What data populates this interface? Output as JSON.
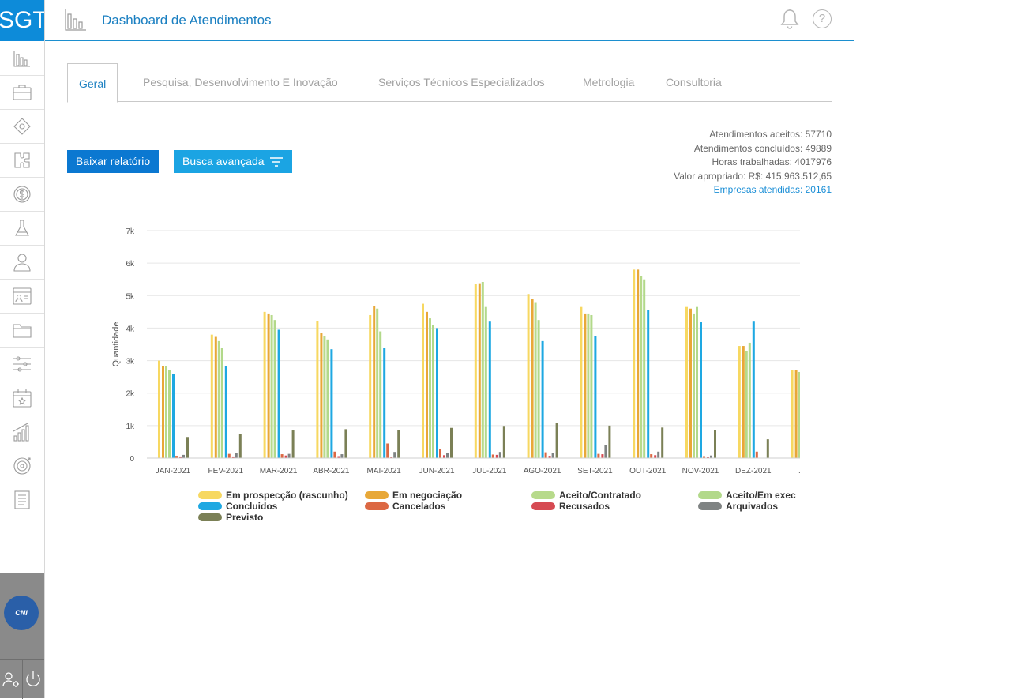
{
  "app": {
    "logo_text": "SGT",
    "title": "Dashboard de Atendimentos",
    "footer_logo_text": "CNI"
  },
  "sidebar": {
    "items": [
      {
        "icon": "bar-chart-icon"
      },
      {
        "icon": "briefcase-icon"
      },
      {
        "icon": "eye-diamond-icon"
      },
      {
        "icon": "puzzle-icon"
      },
      {
        "icon": "dollar-coin-icon"
      },
      {
        "icon": "flask-icon"
      },
      {
        "icon": "user-icon"
      },
      {
        "icon": "id-card-icon"
      },
      {
        "icon": "folder-icon"
      },
      {
        "icon": "sliders-icon"
      },
      {
        "icon": "calendar-star-icon"
      },
      {
        "icon": "growth-chart-icon"
      },
      {
        "icon": "target-icon"
      },
      {
        "icon": "document-list-icon"
      }
    ]
  },
  "header": {
    "bell_icon": "bell-icon",
    "help_label": "?"
  },
  "tabs": [
    {
      "label": "Geral",
      "active": true
    },
    {
      "label": "Pesquisa, Desenvolvimento E Inovação",
      "active": false
    },
    {
      "label": "Serviços Técnicos Especializados",
      "active": false
    },
    {
      "label": "Metrologia",
      "active": false
    },
    {
      "label": "Consultoria",
      "active": false
    }
  ],
  "buttons": {
    "report": "Baixar relatório",
    "search": "Busca avançada"
  },
  "stats": {
    "accepted": "Atendimentos aceitos: 57710",
    "concluded": "Atendimentos concluídos: 49889",
    "hours": "Horas trabalhadas: 4017976",
    "value": "Valor apropriado: R$: 415.963.512,65",
    "companies": "Empresas atendidas: 20161"
  },
  "chart_data": {
    "type": "bar",
    "ylabel": "Quantidade",
    "ylim": [
      0,
      7000
    ],
    "yticks": [
      "0",
      "1k",
      "2k",
      "3k",
      "4k",
      "5k",
      "6k",
      "7k"
    ],
    "grid": true,
    "legend_position": "bottom",
    "categories": [
      "JAN-2021",
      "FEV-2021",
      "MAR-2021",
      "ABR-2021",
      "MAI-2021",
      "JUN-2021",
      "JUL-2021",
      "AGO-2021",
      "SET-2021",
      "OUT-2021",
      "NOV-2021",
      "DEZ-2021",
      "JAN"
    ],
    "series": [
      {
        "name": "Em prospecção (rascunho)",
        "color": "#f7d861",
        "values": [
          3000,
          3800,
          4500,
          4220,
          4400,
          4750,
          5350,
          5050,
          4650,
          5800,
          4650,
          3450,
          2700
        ]
      },
      {
        "name": "Em negociação",
        "color": "#e8a838",
        "values": [
          2830,
          3730,
          4450,
          3850,
          4670,
          4500,
          5380,
          4900,
          4450,
          5800,
          4600,
          3450,
          2700
        ]
      },
      {
        "name": "Aceito/Contratado",
        "color": "#b7da8b",
        "values": [
          2840,
          3600,
          4400,
          3750,
          4600,
          4300,
          5420,
          4800,
          4450,
          5600,
          4450,
          3300,
          2650
        ]
      },
      {
        "name": "Aceito/Em exec",
        "color": "#b2d98a",
        "values": [
          2700,
          3400,
          4250,
          3650,
          3900,
          4100,
          4650,
          4250,
          4400,
          5500,
          4650,
          3550,
          null
        ]
      },
      {
        "name": "Concluidos",
        "color": "#1ea8e2",
        "values": [
          2580,
          2830,
          3950,
          3350,
          3400,
          4000,
          4200,
          3600,
          3750,
          4550,
          4180,
          4200,
          null
        ]
      },
      {
        "name": "Cancelados",
        "color": "#dc6843",
        "values": [
          70,
          130,
          120,
          200,
          450,
          270,
          110,
          180,
          130,
          120,
          60,
          200,
          null
        ]
      },
      {
        "name": "Recusados",
        "color": "#d64a52",
        "values": [
          50,
          50,
          80,
          60,
          40,
          90,
          100,
          70,
          120,
          90,
          40,
          0,
          null
        ]
      },
      {
        "name": "Arquivados",
        "color": "#7f8383",
        "values": [
          100,
          160,
          130,
          120,
          190,
          150,
          190,
          160,
          400,
          200,
          80,
          0,
          null
        ]
      },
      {
        "name": "Previsto",
        "color": "#7b8056",
        "values": [
          650,
          740,
          850,
          890,
          870,
          930,
          990,
          1080,
          1000,
          940,
          870,
          580,
          null
        ]
      }
    ]
  }
}
